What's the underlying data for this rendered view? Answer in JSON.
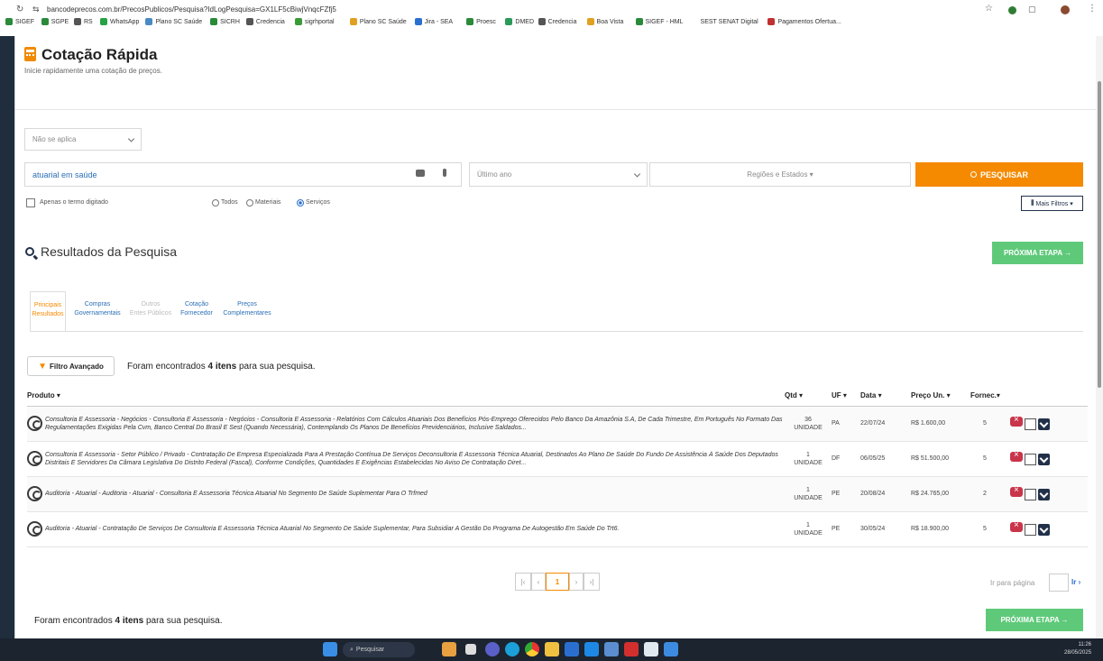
{
  "browser": {
    "url": "bancodeprecos.com.br/PrecosPublicos/Pesquisa?IdLogPesquisa=GX1LF5cBiwjVnqcFZfj5",
    "bookmarks": [
      {
        "label": "SIGEF",
        "color": "#2a8a3a"
      },
      {
        "label": "SGPE",
        "color": "#2a8a3a"
      },
      {
        "label": "RS",
        "color": "#555"
      },
      {
        "label": "WhatsApp",
        "color": "#25a244"
      },
      {
        "label": "Plano SC Saúde",
        "color": "#4a8ac4"
      },
      {
        "label": "SICRH",
        "color": "#2a8a3a"
      },
      {
        "label": "Credencia",
        "color": "#555"
      },
      {
        "label": "sigrhportal",
        "color": "#3a9a3a"
      },
      {
        "label": "Plano SC Saúde",
        "color": "#e0a020"
      },
      {
        "label": "Jira - SEA",
        "color": "#2a6fd0"
      },
      {
        "label": "Proesc",
        "color": "#2a8a3a"
      },
      {
        "label": "DMED",
        "color": "#2a9a5a"
      },
      {
        "label": "Credencia",
        "color": "#555"
      },
      {
        "label": "Boa Vista",
        "color": "#e0a020"
      },
      {
        "label": "SIGEF - HML",
        "color": "#2a8a3a"
      },
      {
        "label": "SEST SENAT Digital",
        "color": "#fff"
      },
      {
        "label": "Pagamentos Ofertua...",
        "color": "#c03030"
      }
    ]
  },
  "header": {
    "title": "Cotação Rápida",
    "subtitle": "Inicie rapidamente uma cotação de preços."
  },
  "search": {
    "orgao_select": "Não se aplica",
    "query_value": "atuarial em saúde",
    "period_select": "Último ano",
    "region_select": "Regiões e Estados ▾",
    "search_button": "PESQUISAR",
    "exact_term_label": "Apenas o termo digitado",
    "radio_all": "Todos",
    "radio_materials": "Materiais",
    "radio_services": "Serviços",
    "more_filters": "Mais Filtros ▾"
  },
  "results": {
    "section_title": "Resultados da Pesquisa",
    "next_step": "PRÓXIMA ETAPA →",
    "tabs": [
      {
        "line1": "Principais",
        "line2": "Resultados",
        "active": true
      },
      {
        "line1": "Compras",
        "line2": "Governamentais",
        "active": false
      },
      {
        "line1": "Outros",
        "line2": "Entes Públicos",
        "active": false
      },
      {
        "line1": "Cotação",
        "line2": "Fornecedor",
        "active": false
      },
      {
        "line1": "Preços",
        "line2": "Complementares",
        "active": false
      }
    ],
    "filter_button": "Filtro Avançado",
    "found_text_pre": "Foram encontrados ",
    "found_count": "4 itens",
    "found_text_post": " para sua pesquisa.",
    "columns": {
      "product": "Produto ▾",
      "qty": "Qtd ▾",
      "uf": "UF ▾",
      "date": "Data ▾",
      "price": "Preço Un. ▾",
      "suppliers": "Fornec.▾"
    },
    "rows": [
      {
        "desc": "Consultoria E Assessoria - Negócios - Consultoria E Assessoria - Negócios - Consultoria E Assessoria - Relatórios Com Cálculos Atuariais Dos Benefícios Pós-Emprego Oferecidos Pelo Banco Da Amazônia S.A, De Cada Trimestre, Em Português No Formato Das Regulamentações Exigidas Pela Cvm, Banco Central Do Brasil E Sest (Quando Necessária), Contemplando Os Planos De Benefícios Previdenciários, Inclusive Saldados...",
        "qty": "36",
        "unit": "UNIDADE",
        "uf": "PA",
        "date": "22/07/24",
        "price": "R$ 1.600,00",
        "suppliers": "5"
      },
      {
        "desc": "Consultoria E Assessoria - Setor Público / Privado - Contratação De Empresa Especializada Para A Prestação Contínua De Serviços Deconsultoria E Assessoria Técnica Atuarial, Destinados Ao Plano De Saúde Do Fundo De Assistência À Saúde Dos Deputados Distritais E Servidores Da Câmara Legislativa Do Distrito Federal (Fascal), Conforme Condições, Quantidades E Exigências Estabelecidas No Aviso De Contratação Diret...",
        "qty": "1",
        "unit": "UNIDADE",
        "uf": "DF",
        "date": "06/05/25",
        "price": "R$ 51.500,00",
        "suppliers": "5"
      },
      {
        "desc": "Auditoria - Atuarial - Auditoria - Atuarial - Consultoria E Assessoria Técnica Atuarial No Segmento De Saúde Suplementar Para O Trfmed",
        "qty": "1",
        "unit": "UNIDADE",
        "uf": "PE",
        "date": "20/08/24",
        "price": "R$ 24.765,00",
        "suppliers": "2"
      },
      {
        "desc": "Auditoria - Atuarial - Contratação De Serviços De Consultoria E Assessoria Técnica Atuarial No Segmento De Saúde Suplementar, Para Subsidiar A Gestão Do Programa De Autogestão Em Saúde Do Trt6.",
        "qty": "1",
        "unit": "UNIDADE",
        "uf": "PE",
        "date": "30/05/24",
        "price": "R$ 18.900,00",
        "suppliers": "5"
      }
    ],
    "pager": {
      "current": "1",
      "goto_label": "Ir para página",
      "goto_button": "Ir"
    }
  },
  "taskbar": {
    "search_placeholder": "Pesquisar",
    "time": "11:26",
    "date": "28/05/2025"
  }
}
